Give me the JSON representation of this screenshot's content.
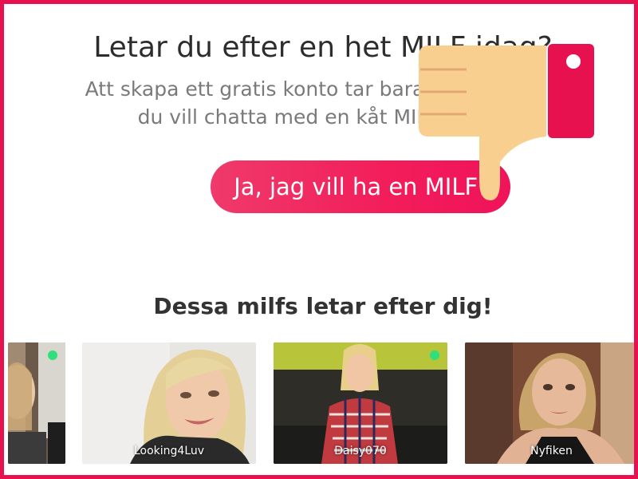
{
  "hero": {
    "headline": "Letar du efter en het MILF idag?",
    "subline_1": "Att skapa ett gratis konto tar bara 30 sekunder,",
    "subline_2": "du vill chatta med en kåt MILF ikväll?",
    "cta_label": "Ja, jag vill ha en MILF!"
  },
  "profiles": {
    "title": "Dessa milfs letar efter dig!",
    "cards": [
      {
        "username": "",
        "online": true
      },
      {
        "username": "Looking4Luv",
        "online": false
      },
      {
        "username": "Daisy070",
        "online": true
      },
      {
        "username": "Nyfiken",
        "online": false
      }
    ]
  },
  "colors": {
    "border": "#e8114f",
    "accent": "#f21d5a",
    "online": "#2fe07a",
    "thumb_skin": "#f9cf8f",
    "thumb_cuff": "#e8114f"
  },
  "overlay": {
    "icon": "thumbs-down-icon"
  }
}
